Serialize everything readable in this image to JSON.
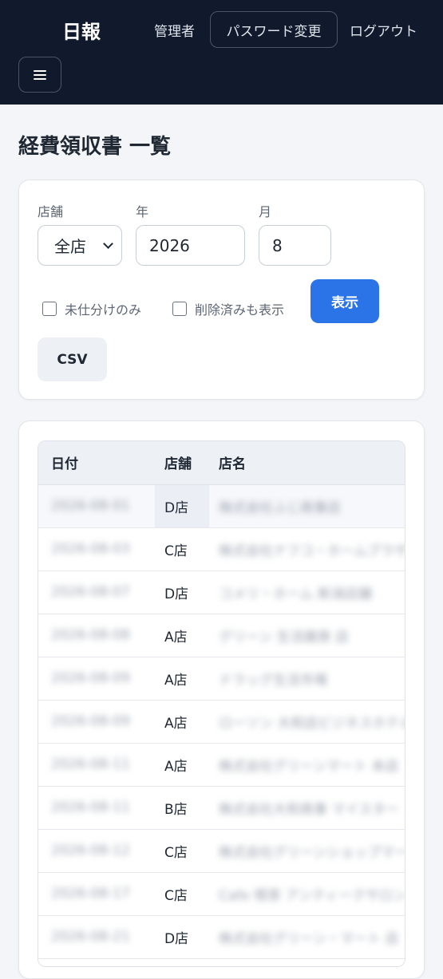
{
  "header": {
    "brand": "日報",
    "admin_label": "管理者",
    "password_change_label": "パスワード変更",
    "logout_label": "ログアウト",
    "menu_icon": "hamburger-icon"
  },
  "page_title": "経費領収書 一覧",
  "filters": {
    "store_label": "店舗",
    "store_value": "全店",
    "year_label": "年",
    "year_value": "2026",
    "month_label": "月",
    "month_value": "8",
    "unassigned_only_label": "未仕分けのみ",
    "unassigned_only_checked": false,
    "show_deleted_label": "削除済みも表示",
    "show_deleted_checked": false,
    "show_button_label": "表示",
    "csv_button_label": "CSV"
  },
  "table": {
    "columns": [
      "日付",
      "店舗",
      "店名"
    ],
    "rows": [
      {
        "date": "2026-08-01",
        "store": "D店",
        "name": "株式会社ふじ商事店"
      },
      {
        "date": "2026-08-03",
        "store": "C店",
        "name": "株式会社ナフコ・ホームプラザ"
      },
      {
        "date": "2026-08-07",
        "store": "D店",
        "name": "コメリ・ホーム 新潟店舗"
      },
      {
        "date": "2026-08-08",
        "store": "A店",
        "name": "グリーン 生活雑貨 店"
      },
      {
        "date": "2026-08-09",
        "store": "A店",
        "name": "ドラッグ生活市場"
      },
      {
        "date": "2026-08-09",
        "store": "A店",
        "name": "ローソン 大和店ビジネスホテル"
      },
      {
        "date": "2026-08-11",
        "store": "A店",
        "name": "株式会社グリーンマート 本店"
      },
      {
        "date": "2026-08-11",
        "store": "B店",
        "name": "株式会社大和商事 マイスター"
      },
      {
        "date": "2026-08-12",
        "store": "C店",
        "name": "株式会社グリーンショップマート"
      },
      {
        "date": "2026-08-17",
        "store": "C店",
        "name": "Cafe 喫茶 アンティークサロン"
      },
      {
        "date": "2026-08-21",
        "store": "D店",
        "name": "株式会社グリーン・マート 店"
      }
    ]
  }
}
